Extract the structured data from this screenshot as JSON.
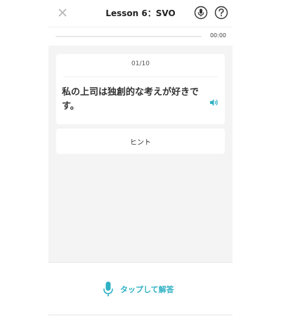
{
  "header": {
    "title": "Lesson 6：SVO",
    "close_icon": "close-icon",
    "mic_icon": "microphone-circle-icon",
    "help_icon": "help-circle-icon"
  },
  "audio": {
    "progress": 0,
    "time": "00:00"
  },
  "question": {
    "counter": "01/10",
    "sentence": "私の上司は独創的な考えが好きです。",
    "speaker_icon": "speaker-icon"
  },
  "hint": {
    "label": "ヒント"
  },
  "answer": {
    "label": "タップして解答",
    "icon": "microphone-icon"
  },
  "colors": {
    "accent": "#2fb1c4",
    "background": "#f4f4f4"
  }
}
